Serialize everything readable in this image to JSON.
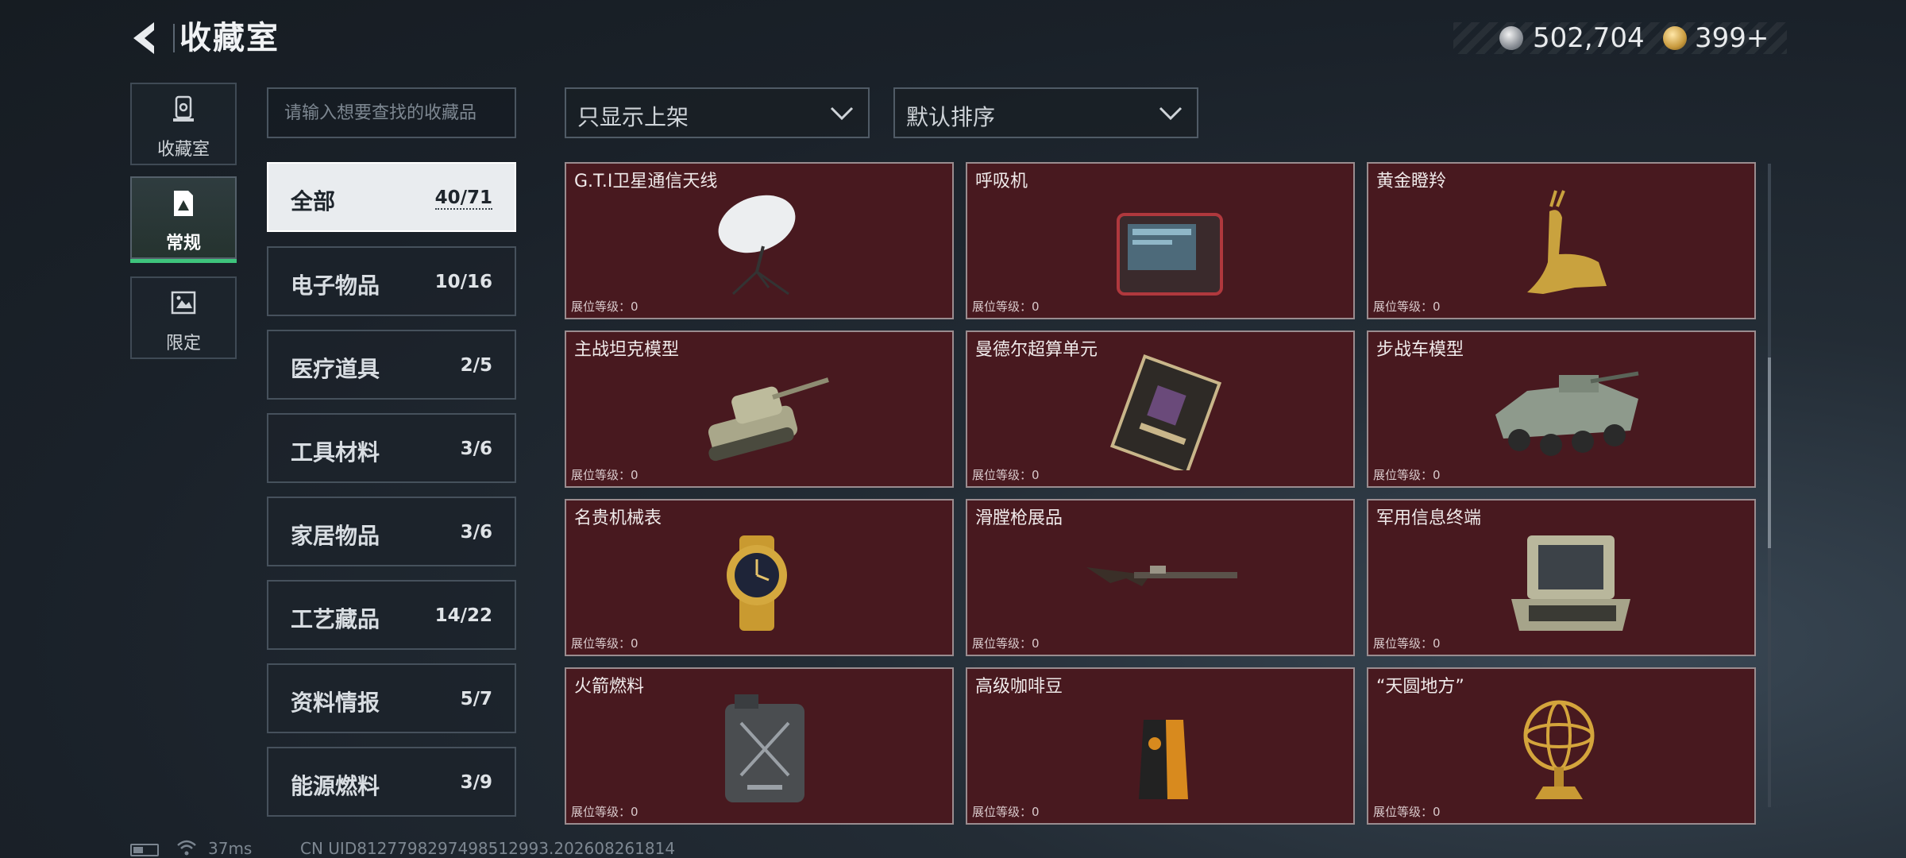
{
  "header": {
    "title": "收藏室",
    "currencies": [
      {
        "icon": "silver-coin-icon",
        "value": "502,704"
      },
      {
        "icon": "gold-coin-icon",
        "value": "399+"
      }
    ]
  },
  "mode_tabs": [
    {
      "label": "收藏室",
      "icon": "collection-room-icon",
      "active": false
    },
    {
      "label": "常规",
      "icon": "regular-image-icon",
      "active": true
    },
    {
      "label": "限定",
      "icon": "limited-image-icon",
      "active": false
    }
  ],
  "search": {
    "placeholder": "请输入想要查找的收藏品"
  },
  "categories": [
    {
      "label": "全部",
      "count": "40/71",
      "active": true
    },
    {
      "label": "电子物品",
      "count": "10/16"
    },
    {
      "label": "医疗道具",
      "count": "2/5"
    },
    {
      "label": "工具材料",
      "count": "3/6"
    },
    {
      "label": "家居物品",
      "count": "3/6"
    },
    {
      "label": "工艺藏品",
      "count": "14/22"
    },
    {
      "label": "资料情报",
      "count": "5/7"
    },
    {
      "label": "能源燃料",
      "count": "3/9"
    }
  ],
  "filters": {
    "availability": "只显示上架",
    "sort": "默认排序"
  },
  "items": [
    {
      "name": "G.T.I卫星通信天线",
      "level": "展位等级：0",
      "icon": "satellite-antenna-icon"
    },
    {
      "name": "呼吸机",
      "level": "展位等级：0",
      "icon": "ventilator-icon"
    },
    {
      "name": "黄金瞪羚",
      "level": "展位等级：0",
      "icon": "golden-gazelle-icon"
    },
    {
      "name": "主战坦克模型",
      "level": "展位等级：0",
      "icon": "tank-model-icon"
    },
    {
      "name": "曼德尔超算单元",
      "level": "展位等级：0",
      "icon": "supercomputer-unit-icon"
    },
    {
      "name": "步战车模型",
      "level": "展位等级：0",
      "icon": "infantry-vehicle-model-icon"
    },
    {
      "name": "名贵机械表",
      "level": "展位等级：0",
      "icon": "luxury-watch-icon"
    },
    {
      "name": "滑膛枪展品",
      "level": "展位等级：0",
      "icon": "musket-icon"
    },
    {
      "name": "军用信息终端",
      "level": "展位等级：0",
      "icon": "military-terminal-icon"
    },
    {
      "name": "火箭燃料",
      "level": "展位等级：0",
      "icon": "rocket-fuel-can-icon"
    },
    {
      "name": "高级咖啡豆",
      "level": "展位等级：0",
      "icon": "coffee-bean-bag-icon"
    },
    {
      "name": "“天圆地方”",
      "level": "展位等级：0",
      "icon": "armillary-sphere-icon"
    }
  ],
  "status_bar": {
    "ping": "37ms",
    "uid": "CN UID8127798297498512993.202608261814"
  }
}
